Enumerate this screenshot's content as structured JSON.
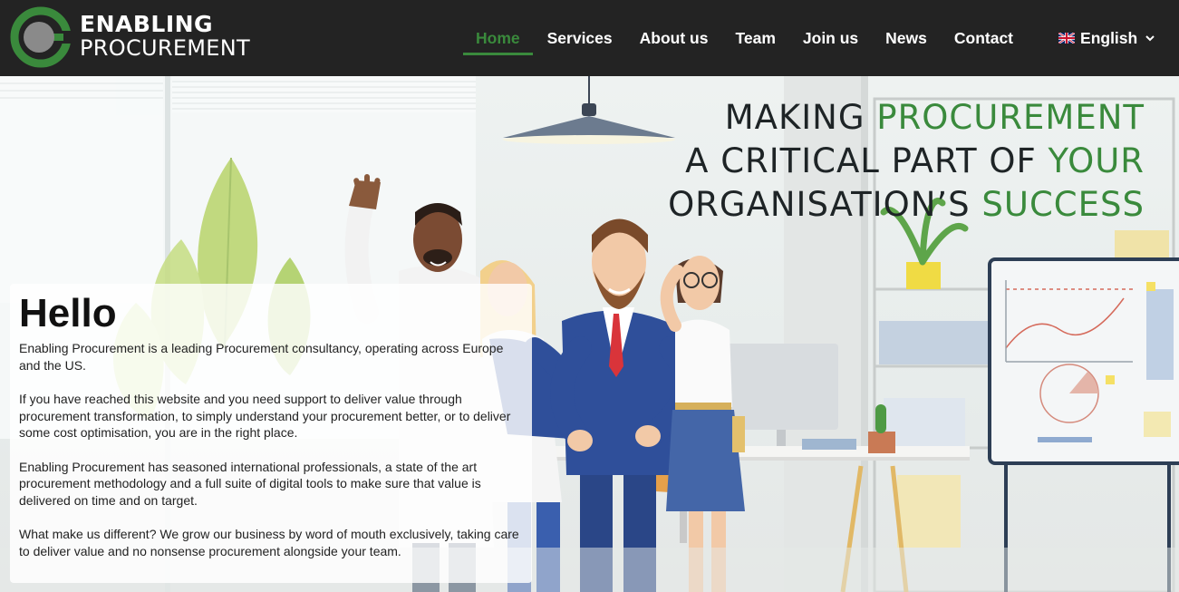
{
  "brand": {
    "line1": "ENABLING",
    "line2": "PROCUREMENT",
    "accent": "#3a8a3c",
    "ring_color": "#3a8a3c",
    "core_color": "#8a8a8a"
  },
  "nav": {
    "items": [
      {
        "label": "Home",
        "active": true
      },
      {
        "label": "Services",
        "active": false
      },
      {
        "label": "About us",
        "active": false
      },
      {
        "label": "Team",
        "active": false
      },
      {
        "label": "Join us",
        "active": false
      },
      {
        "label": "News",
        "active": false
      },
      {
        "label": "Contact",
        "active": false
      }
    ],
    "language": {
      "label": "English",
      "icon": "uk-flag-icon"
    }
  },
  "hero": {
    "headline": {
      "line1": {
        "a": "MAKING ",
        "b": "PROCUREMENT"
      },
      "line2": {
        "a": "A CRITICAL PART OF ",
        "b": "YOUR"
      },
      "line3": {
        "a": "ORGANISATION’S ",
        "b": "SUCCESS"
      }
    }
  },
  "hello": {
    "title": "Hello",
    "paragraphs": [
      "Enabling Procurement is a leading Procurement consultancy, operating across Europe and the US.",
      "If you have reached this website and you need support to deliver value through procurement transformation, to simply understand your procurement better, or to deliver some cost optimisation, you are in the right place.",
      "Enabling Procurement has seasoned international professionals, a state of the art procurement methodology and a full suite of digital tools to make sure that value is delivered on time and on target.",
      "What make us different? We grow our business by word of mouth exclusively, taking care to deliver value and no nonsense procurement alongside your team."
    ]
  }
}
